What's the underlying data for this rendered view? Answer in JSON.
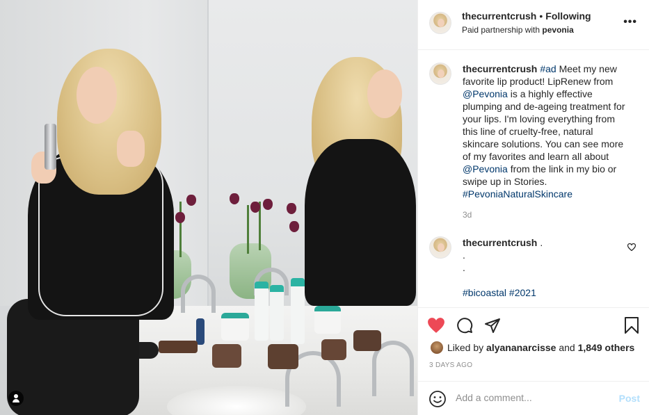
{
  "post": {
    "username": "thecurrentcrush",
    "follow_separator": "•",
    "follow_status": "Following",
    "partnership_prefix": "Paid partnership with",
    "partner": "pevonia",
    "more_icon": "more-options-icon"
  },
  "caption": {
    "username": "thecurrentcrush",
    "hashtag_ad": "#ad",
    "text_1": "Meet my new favorite lip product! LipRenew from",
    "mention_1": "@Pevonia",
    "text_2": "is a highly effective plumping and de-ageing treatment for your lips. I'm loving everything from this line of cruelty-free, natural skincare solutions. You can see more of my favorites and learn all about",
    "mention_2": "@Pevonia",
    "text_3": "from the link in my bio or swipe up in Stories.",
    "hashtag_brand": "#PevoniaNaturalSkincare",
    "age": "3d"
  },
  "comment": {
    "username": "thecurrentcrush",
    "line_1": ".",
    "line_2": ".",
    "line_3": ".",
    "tags": "#bicoastal #2021"
  },
  "actions": {
    "like_color": "#ed4956",
    "liked_prefix": "Liked by",
    "liked_user": "alyananarcisse",
    "liked_mid": "and",
    "liked_count": "1,849 others",
    "timestamp": "3 DAYS AGO"
  },
  "add_comment": {
    "placeholder": "Add a comment...",
    "post_label": "Post"
  }
}
